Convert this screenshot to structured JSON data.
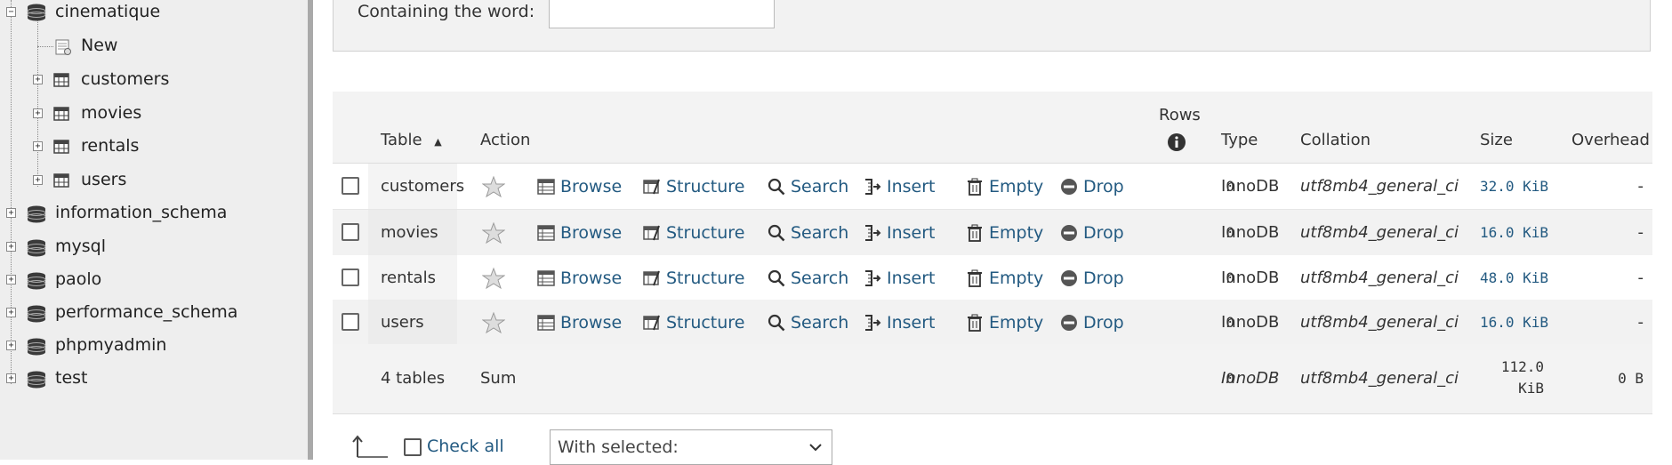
{
  "sidebar": {
    "databases": [
      {
        "name": "cinematique",
        "expander": "−",
        "children": [
          {
            "name": "New"
          },
          {
            "name": "customers"
          },
          {
            "name": "movies"
          },
          {
            "name": "rentals"
          },
          {
            "name": "users"
          }
        ]
      },
      {
        "name": "information_schema",
        "expander": "+"
      },
      {
        "name": "mysql",
        "expander": "+"
      },
      {
        "name": "paolo",
        "expander": "+"
      },
      {
        "name": "performance_schema",
        "expander": "+"
      },
      {
        "name": "phpmyadmin",
        "expander": "+"
      },
      {
        "name": "test",
        "expander": "+"
      }
    ],
    "child_expander": "+"
  },
  "search": {
    "containing_label": "Containing the word:",
    "input_value": ""
  },
  "table": {
    "headers": {
      "table": "Table",
      "sort_indicator": "▲",
      "action": "Action",
      "rows": "Rows",
      "type": "Type",
      "collation": "Collation",
      "size": "Size",
      "overhead": "Overhead"
    },
    "action_labels": {
      "browse": "Browse",
      "structure": "Structure",
      "search": "Search",
      "insert": "Insert",
      "empty": "Empty",
      "drop": "Drop"
    },
    "rows": [
      {
        "name": "customers",
        "rows": "0",
        "type": "InnoDB",
        "collation": "utf8mb4_general_ci",
        "size": "32.0 KiB",
        "overhead": "-"
      },
      {
        "name": "movies",
        "rows": "0",
        "type": "InnoDB",
        "collation": "utf8mb4_general_ci",
        "size": "16.0 KiB",
        "overhead": "-"
      },
      {
        "name": "rentals",
        "rows": "0",
        "type": "InnoDB",
        "collation": "utf8mb4_general_ci",
        "size": "48.0 KiB",
        "overhead": "-"
      },
      {
        "name": "users",
        "rows": "0",
        "type": "InnoDB",
        "collation": "utf8mb4_general_ci",
        "size": "16.0 KiB",
        "overhead": "-"
      }
    ],
    "summary": {
      "count": "4 tables",
      "label": "Sum",
      "rows": "0",
      "type": "InnoDB",
      "collation": "utf8mb4_general_ci",
      "size_value": "112.0",
      "size_unit": "KiB",
      "overhead": "0 B"
    }
  },
  "bottom": {
    "check_all": "Check all",
    "with_selected": "With selected:"
  },
  "colors": {
    "link": "#235a81",
    "sidebar_bg": "#eeeeee",
    "sidebar_border": "#a9a9a9",
    "header_bg": "#f3f3f3"
  },
  "icons": {
    "database": "database-icon",
    "table": "table-icon",
    "new": "new-table-icon",
    "favorite": "star-icon",
    "browse": "browse-icon",
    "structure": "structure-icon",
    "search": "magnifier-icon",
    "insert": "insert-icon",
    "empty": "trash-icon",
    "drop": "drop-icon",
    "info": "info-icon",
    "check_all_arrow": "arrow-up-left-icon",
    "select_caret": "chevron-down-icon"
  }
}
